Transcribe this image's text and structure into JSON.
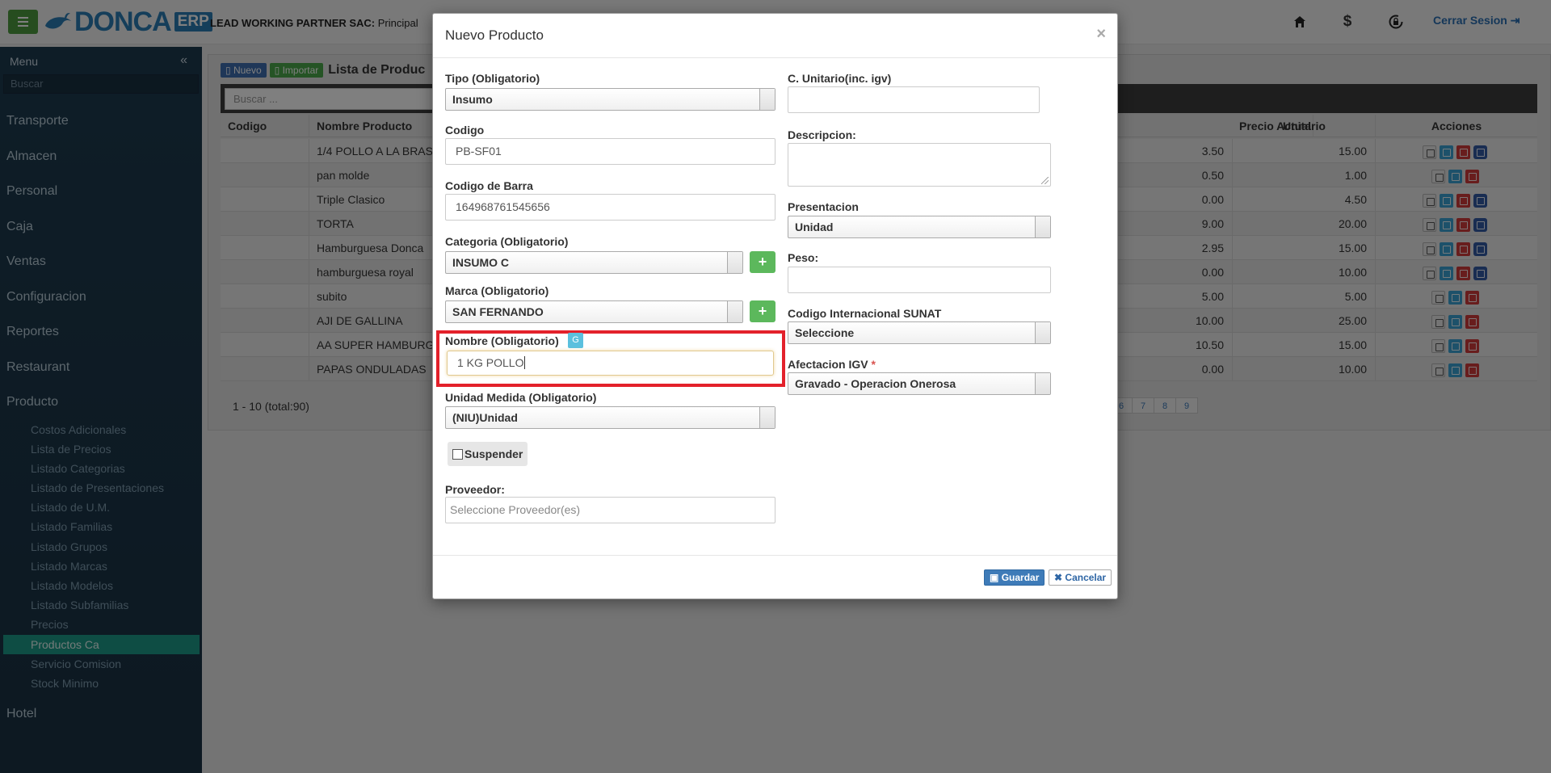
{
  "topbar": {
    "logo_text": "DONCA",
    "logo_erp": "ERP",
    "company_bold": "LEAD WORKING PARTNER SAC:",
    "company_rest": " Principal",
    "logout": "Cerrar Sesion"
  },
  "sidebar": {
    "menu_title": "Menu",
    "search_placeholder": "Buscar",
    "items": [
      "Transporte",
      "Almacen",
      "Personal",
      "Caja",
      "Ventas",
      "Configuracion",
      "Reportes",
      "Restaurant",
      "Producto"
    ],
    "subitems": [
      "Costos Adicionales",
      "Lista de Precios",
      "Listado Categorias",
      "Listado de Presentaciones",
      "Listado de U.M.",
      "Listado Familias",
      "Listado Grupos",
      "Listado Marcas",
      "Listado Modelos",
      "Listado Subfamilias",
      "Precios",
      "Productos Ca",
      "Servicio Comision",
      "Stock Minimo"
    ],
    "active_subitem": "Productos Ca",
    "last_item": "Hotel"
  },
  "list": {
    "btn_new": "Nuevo",
    "btn_import": "Importar",
    "title": "Lista de Produc",
    "search_placeholder": "Buscar ...",
    "headers": {
      "codigo": "Codigo",
      "nombre": "Nombre Producto",
      "unitario": "Unitario",
      "precio": "Precio Actual",
      "acciones": "Acciones"
    },
    "rows": [
      {
        "nombre": "1/4 POLLO A LA BRAS",
        "unitario": "3.50",
        "precio": "15.00",
        "actions": 4
      },
      {
        "nombre": "pan molde",
        "unitario": "0.50",
        "precio": "1.00",
        "actions": 3
      },
      {
        "nombre": "Triple Clasico",
        "unitario": "0.00",
        "precio": "4.50",
        "actions": 4
      },
      {
        "nombre": "TORTA",
        "unitario": "9.00",
        "precio": "20.00",
        "actions": 4
      },
      {
        "nombre": "Hamburguesa Donca",
        "unitario": "2.95",
        "precio": "15.00",
        "actions": 4
      },
      {
        "nombre": "hamburguesa royal",
        "unitario": "0.00",
        "precio": "10.00",
        "actions": 4
      },
      {
        "nombre": "subito",
        "unitario": "5.00",
        "precio": "5.00",
        "actions": 3
      },
      {
        "nombre": "AJI DE GALLINA",
        "unitario": "10.00",
        "precio": "25.00",
        "actions": 3
      },
      {
        "nombre": "AA SUPER HAMBURG",
        "unitario": "10.50",
        "precio": "15.00",
        "actions": 3
      },
      {
        "nombre": "PAPAS ONDULADAS",
        "unitario": "0.00",
        "precio": "10.00",
        "actions": 3
      }
    ],
    "pager_info": "1 - 10 (total:90)",
    "pages": [
      "6",
      "7",
      "8",
      "9"
    ]
  },
  "modal": {
    "title": "Nuevo Producto",
    "close": "×",
    "tipo_label": "Tipo (Obligatorio)",
    "tipo_value": "Insumo",
    "codigo_label": "Codigo",
    "codigo_value": "PB-SF01",
    "barra_label": "Codigo de Barra",
    "barra_value": "164968761545656",
    "categoria_label": "Categoria (Obligatorio)",
    "categoria_value": "INSUMO C",
    "marca_label": "Marca (Obligatorio)",
    "marca_value": "SAN FERNANDO",
    "nombre_label": "Nombre (Obligatorio)",
    "nombre_badge": "G",
    "nombre_value": "1 KG POLLO",
    "um_label": "Unidad Medida (Obligatorio)",
    "um_value": "(NIU)Unidad",
    "suspender_label": "Suspender",
    "proveedor_label": "Proveedor:",
    "proveedor_placeholder": "Seleccione Proveedor(es)",
    "cunitario_label": "C. Unitario(inc. igv)",
    "cunitario_value": "",
    "descripcion_label": "Descripcion:",
    "presentacion_label": "Presentacion",
    "presentacion_value": "Unidad",
    "peso_label": "Peso:",
    "peso_value": "",
    "sunat_label": "Codigo Internacional SUNAT",
    "sunat_value": "Seleccione",
    "igv_label": "Afectacion IGV",
    "igv_required": "*",
    "igv_value": "Gravado - Operacion Onerosa",
    "btn_save": "Guardar",
    "btn_cancel": "Cancelar"
  },
  "colors": {
    "accent": "#2a7db5",
    "highlight": "#e3212b",
    "active_menu": "#1c9b88"
  }
}
